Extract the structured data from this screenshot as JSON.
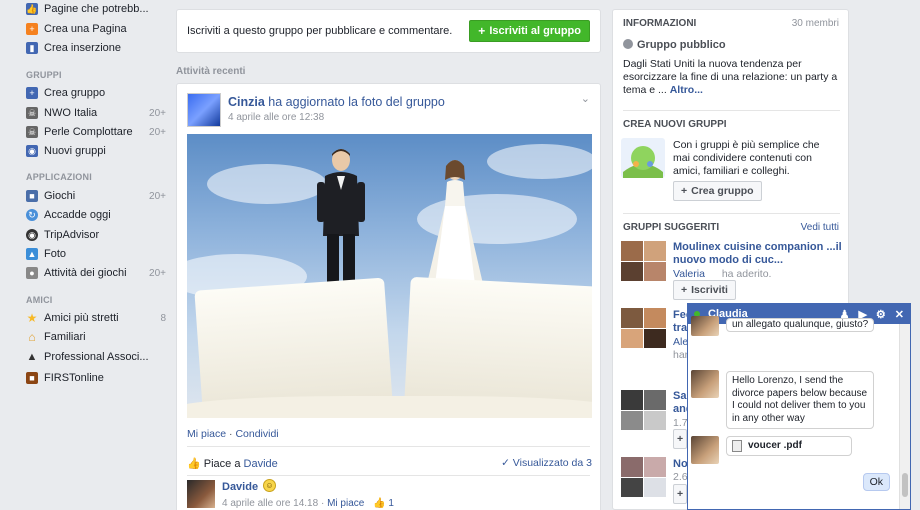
{
  "sidebar": {
    "top_items": [
      {
        "label": "Pagine che potrebb...",
        "icon": "thumbs-up-icon",
        "color": "#4267b2"
      },
      {
        "label": "Crea una Pagina",
        "icon": "flag-icon",
        "color": "#f5811f"
      },
      {
        "label": "Crea inserzione",
        "icon": "chart-icon",
        "color": "#4267b2"
      }
    ],
    "sections": {
      "gruppi": "GRUPPI",
      "applicazioni": "APPLICAZIONI",
      "amici": "AMICI"
    },
    "gruppi": [
      {
        "label": "Crea gruppo",
        "count": "",
        "icon": "plus-icon",
        "color": "#4267b2"
      },
      {
        "label": "NWO Italia",
        "count": "20+",
        "icon": "skull-icon",
        "color": "#555555"
      },
      {
        "label": "Perle Complottare",
        "count": "20+",
        "icon": "skull-icon",
        "color": "#555555"
      },
      {
        "label": "Nuovi gruppi",
        "count": "",
        "icon": "group-icon",
        "color": "#4267b2"
      }
    ],
    "applicazioni": [
      {
        "label": "Giochi",
        "count": "20+",
        "icon": "game-icon",
        "color": "#4a6ea9"
      },
      {
        "label": "Accadde oggi",
        "count": "",
        "icon": "clock-icon",
        "color": "#4a90d9"
      },
      {
        "label": "TripAdvisor",
        "count": "",
        "icon": "owl-icon",
        "color": "#333333"
      },
      {
        "label": "Foto",
        "count": "",
        "icon": "photo-icon",
        "color": "#3b8ed8"
      },
      {
        "label": "Attività dei giochi",
        "count": "20+",
        "icon": "controller-icon",
        "color": "#888888"
      }
    ],
    "amici": [
      {
        "label": "Amici più stretti",
        "count": "8",
        "icon": "star-icon",
        "color": "#f7b928"
      },
      {
        "label": "Familiari",
        "count": "",
        "icon": "house-icon",
        "color": "#e0a030"
      },
      {
        "label": "Professional Associ...",
        "count": "",
        "icon": "graduation-cap-icon",
        "color": "#333333"
      },
      {
        "label": "FIRSTonline",
        "count": "",
        "icon": "briefcase-icon",
        "color": "#8b4513"
      }
    ]
  },
  "join": {
    "text": "Iscriviti a questo gruppo per pubblicare e commentare.",
    "button": "Iscriviti al gruppo"
  },
  "recent_title": "Attività recenti",
  "post": {
    "author": "Cinzia",
    "action": "ha aggiornato la foto del gruppo",
    "time": "4 aprile alle ore 12:38",
    "like_link": "Mi piace",
    "sep": " · ",
    "share_link": "Condividi",
    "likes_prefix": "Piace a",
    "likes_name": "Davide",
    "seen": "Visualizzato da 3",
    "comment": {
      "author": "Davide",
      "emoji": "smile-emoji",
      "time": "4 aprile alle ore 14.18",
      "sep": " · ",
      "like": "Mi piace",
      "like_count": "1"
    }
  },
  "right": {
    "info_title": "INFORMAZIONI",
    "members": "30 membri",
    "privacy": "Gruppo pubblico",
    "description": "Dagli Stati Uniti la nuova tendenza per esorcizzare la fine di una relazione: un party a tema e ...",
    "more": "Altro...",
    "create_title": "CREA NUOVI GRUPPI",
    "create_text": "Con i gruppi è più semplice che mai condividere contenuti con amici, familiari e colleghi.",
    "create_button": "Crea gruppo",
    "suggested_title": "GRUPPI SUGGERITI",
    "see_all": "Vedi tutti",
    "suggested": [
      {
        "name": "Moulinex cuisine companion ...il nuovo modo di cuc...",
        "member": "Valeria",
        "member_action": "ha aderito.",
        "button": "Iscriviti"
      },
      {
        "name_fragment": "Fec",
        "name_fragment2": "tra",
        "member": "Ales",
        "member_action": "han"
      },
      {
        "name_fragment": "Sal",
        "name_fragment2": "and",
        "member": "1.75"
      },
      {
        "name_fragment": "Nor",
        "member": "2.65"
      }
    ]
  },
  "chat": {
    "name": "Claudia",
    "partial_message": "un allegato qualunque, giusto?",
    "message": "Hello Lorenzo, I send the divorce papers below because I could not deliver them to you in any other way",
    "attachment": "voucer .pdf",
    "reply": "Ok"
  }
}
